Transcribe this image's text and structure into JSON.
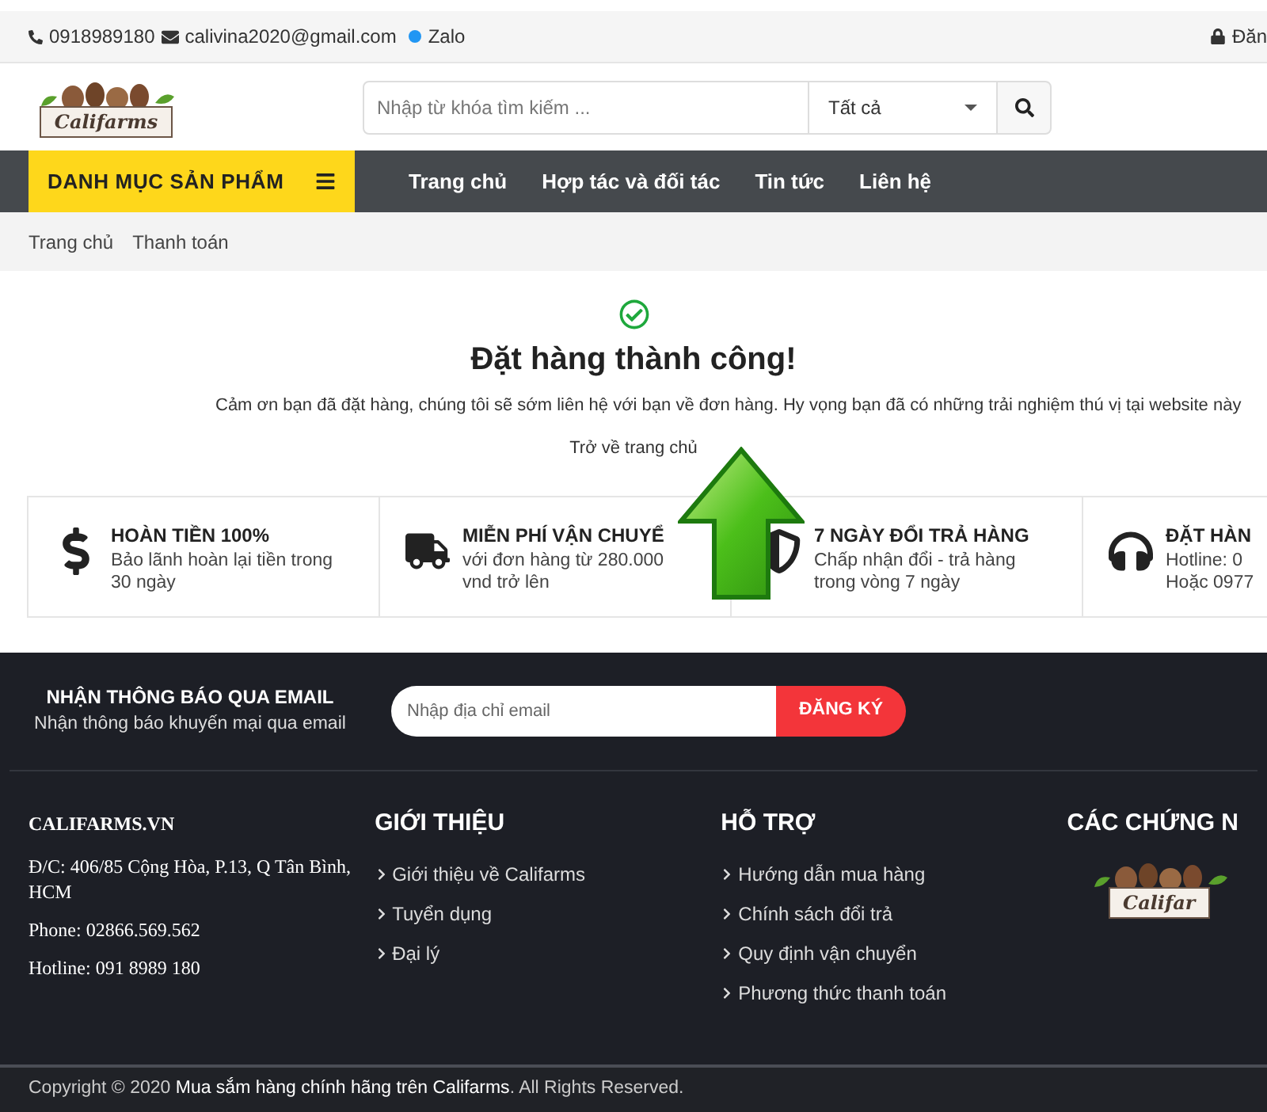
{
  "top_bar": {
    "phone": "0918989180",
    "email": "calivina2020@gmail.com",
    "zalo": "Zalo",
    "login": "Đăn"
  },
  "header": {
    "logo_text": "Califarms",
    "search": {
      "placeholder": "Nhập từ khóa tìm kiếm ..."
    },
    "category_select": "Tất cả"
  },
  "nav": {
    "category_menu": "DANH MỤC SẢN PHẨM",
    "items": [
      {
        "label": "Trang chủ"
      },
      {
        "label": "Hợp tác và đối tác"
      },
      {
        "label": "Tin tức"
      },
      {
        "label": "Liên hệ"
      }
    ]
  },
  "breadcrumb": [
    "Trang chủ",
    "Thanh toán"
  ],
  "success": {
    "title": "Đặt hàng thành công!",
    "message": "Cảm ơn bạn đã đặt hàng, chúng tôi sẽ sớm liên hệ với bạn về đơn hàng. Hy vọng bạn đã có những trải nghiệm thú vị tại website này",
    "home_link": "Trở về trang chủ"
  },
  "features": [
    {
      "kind": "dollar",
      "title": "HOÀN TIỀN 100%",
      "lines": [
        "Bảo lãnh hoàn lại tiền trong",
        "30 ngày"
      ]
    },
    {
      "kind": "truck",
      "title": "MIỄN PHÍ VẬN CHUYỂ",
      "lines": [
        "với đơn hàng từ 280.000",
        "vnd trở lên"
      ]
    },
    {
      "kind": "shield",
      "title": "7 NGÀY ĐỔI TRẢ HÀNG",
      "lines": [
        "Chấp nhận đổi - trả hàng",
        "trong vòng 7 ngày"
      ]
    },
    {
      "kind": "headset",
      "title": "ĐẶT HÀN",
      "lines": [
        "Hotline: 0",
        "Hoặc 0977"
      ]
    }
  ],
  "newsletter": {
    "title": "NHẬN THÔNG BÁO QUA EMAIL",
    "subtitle": "Nhận thông báo khuyến mại qua email",
    "placeholder": "Nhập địa chỉ email",
    "button": "ĐĂNG KÝ"
  },
  "footer": {
    "company": {
      "title": "CALIFARMS.VN",
      "lines": [
        "Đ/C: 406/85 Cộng Hòa, P.13, Q Tân Bình, HCM",
        "Phone: 02866.569.562",
        "Hotline: 091 8989 180"
      ]
    },
    "columns": [
      {
        "title": "GIỚI THIỆU",
        "links": [
          "Giới thiệu về Califarms",
          "Tuyển dụng",
          "Đại lý"
        ]
      },
      {
        "title": "HỖ TRỢ",
        "links": [
          "Hướng dẫn mua hàng",
          "Chính sách đổi trả",
          "Quy định vận chuyển",
          "Phương thức thanh toán"
        ]
      }
    ],
    "certificates": {
      "title": "CÁC CHỨNG N",
      "logo_text": "Califar"
    }
  },
  "copyright": {
    "prefix": "Copyright © 2020 ",
    "highlight": "Mua sắm hàng chính hãng trên Califarms",
    "suffix": ". All Rights Reserved."
  }
}
